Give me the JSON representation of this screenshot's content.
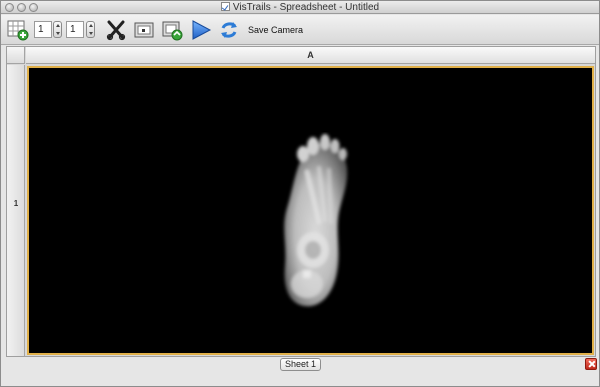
{
  "window": {
    "title": "VisTrails - Spreadsheet - Untitled"
  },
  "toolbar": {
    "row_count": "1",
    "column_count": "1",
    "save_camera_label": "Save Camera",
    "icons": [
      "new-sheet-icon",
      "delete-cell-icon",
      "cell-capture-icon",
      "pipeline-capture-icon",
      "play-icon",
      "sync-icon"
    ]
  },
  "sheet": {
    "column_header": "A",
    "row_header": "1",
    "cell_content": "foot-xray-volume-render",
    "selection_color": "#e0b04a",
    "cell_background": "#000000"
  },
  "tabs": [
    {
      "label": "Sheet 1"
    }
  ],
  "colors": {
    "close_sheet": "#d43a2a",
    "play": "#2f77d6"
  }
}
